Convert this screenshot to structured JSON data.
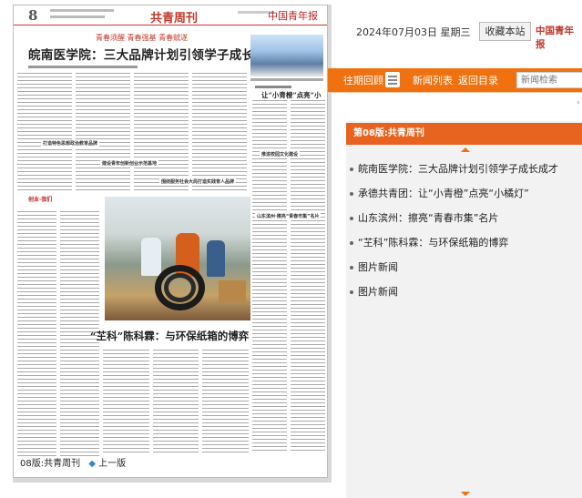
{
  "newspaper": {
    "page_number": "8",
    "column_name": "共青周刊",
    "logo_text": "中国青年报",
    "slogan": "青春须醒 青春强基 青春赋遂",
    "headline_main": "皖南医学院：三大品牌计划引领学子成长成才",
    "sub_headline": "让“小青橙”点亮“小橘灯”",
    "headline_second": "“芏科”陈科霖：与环保纸箱的博弈",
    "section_titles": [
      "打造特色思想政治教育品牌",
      "建设青年创新创业示范基地",
      "围绕服务社会大局打造实践育人品牌",
      "推进校园文化建设",
      "山东滨州·擦亮“青春市集”名片"
    ],
    "footer_section": "08版:共青周刊",
    "footer_prev_link": "上一版"
  },
  "header": {
    "date": "2024年07月03日 星期三",
    "bookmark_button": "收藏本站",
    "brand": "中国青年报"
  },
  "nav": {
    "past_review": "往期回顾",
    "news_list": "新闻列表",
    "back_to_contents": "返回目录",
    "search_placeholder": "新闻检索"
  },
  "sidebar": {
    "section_tab": "第08版:共青周刊",
    "items": [
      {
        "label": "皖南医学院：三大品牌计划引领学子成长成才"
      },
      {
        "label": "承德共青团：让“小青橙”点亮“小橘灯”"
      },
      {
        "label": "山东滨州：擦亮“青春市集”名片"
      },
      {
        "label": "“芏科”陈科霖：与环保纸箱的博弈"
      },
      {
        "label": "图片新闻"
      },
      {
        "label": "图片新闻"
      }
    ]
  },
  "colors": {
    "accent_orange": "#f0710f",
    "tab_orange": "#e76420",
    "masthead_red": "#c0392b",
    "link_blue": "#2f86d6"
  }
}
